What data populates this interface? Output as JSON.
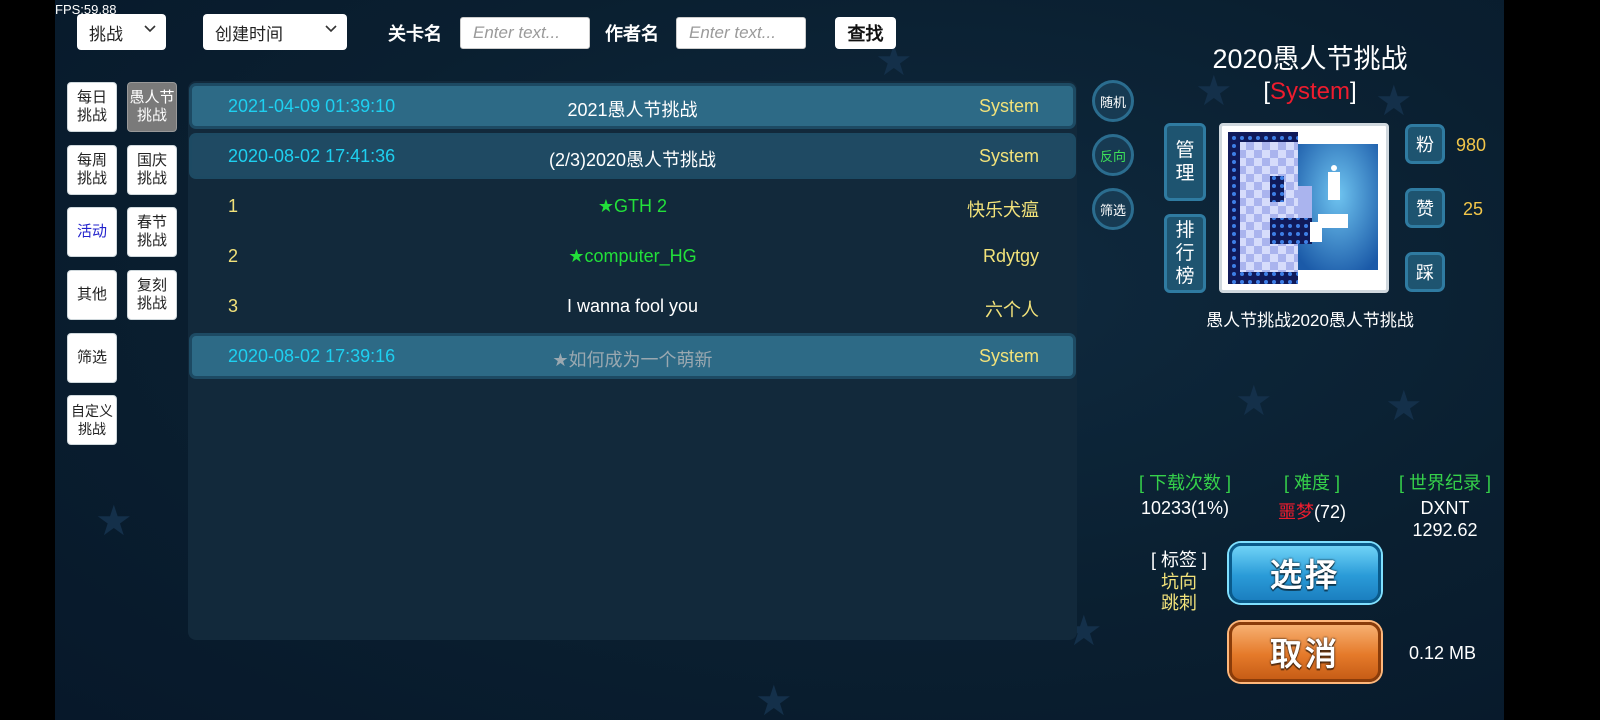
{
  "fps": "FPS:59.88",
  "topbar": {
    "type_select": "挑战",
    "sort_select": "创建时间",
    "level_label": "关卡名",
    "level_placeholder": "Enter text...",
    "author_label": "作者名",
    "author_placeholder": "Enter text...",
    "search_label": "查找"
  },
  "categories": [
    {
      "label": "每日\n挑战"
    },
    {
      "label": "愚人节\n挑战"
    },
    {
      "label": "每周\n挑战"
    },
    {
      "label": "国庆\n挑战"
    },
    {
      "label": "活动"
    },
    {
      "label": "春节\n挑战"
    },
    {
      "label": "其他"
    },
    {
      "label": "复刻\n挑战"
    },
    {
      "label": "筛选"
    },
    {
      "label": "自定义\n挑战"
    }
  ],
  "list": [
    {
      "date": "2021-04-09 01:39:10",
      "title": "2021愚人节挑战",
      "author": "System"
    },
    {
      "date": "2020-08-02 17:41:36",
      "title": "(2/3)2020愚人节挑战",
      "author": "System"
    },
    {
      "index": "1",
      "title": "★GTH 2",
      "author": "快乐犬瘟"
    },
    {
      "index": "2",
      "title": "★computer_HG",
      "author": "Rdytgy"
    },
    {
      "index": "3",
      "title": "I wanna fool you",
      "author": "六个人"
    },
    {
      "date": "2020-08-02 17:39:16",
      "title": "★如何成为一个萌新",
      "author": "System"
    }
  ],
  "side_buttons": {
    "random": "随机",
    "reverse": "反向",
    "filter": "筛选"
  },
  "detail": {
    "title": "2020愚人节挑战",
    "bracket_open": "[",
    "author": "System",
    "bracket_close": "]",
    "manage": "管\n理",
    "ranking": "排\n行\n榜",
    "fans_label": "粉",
    "fans": "980",
    "likes_label": "赞",
    "likes": "25",
    "dislike_label": "踩",
    "description": "愚人节挑战2020愚人节挑战",
    "downloads_head": "[ 下载次数 ]",
    "downloads": "10233(1%)",
    "difficulty_head": "[ 难度 ]",
    "difficulty_name": "噩梦",
    "difficulty_value": "(72)",
    "record_head": "[ 世界纪录 ]",
    "record_holder": "DXNT",
    "record_time": "1292.62",
    "tags_head": "[ 标签 ]",
    "tags": [
      "坑向",
      "跳刺"
    ],
    "select_button": "选择",
    "cancel_button": "取消",
    "size": "0.12 MB"
  },
  "colors": {
    "date": "#1ed0f0",
    "author_yellow": "#f2e27a",
    "star_green": "#22e03a",
    "difficulty_red": "#ee1c2e",
    "info_head_green": "#35d04a"
  }
}
